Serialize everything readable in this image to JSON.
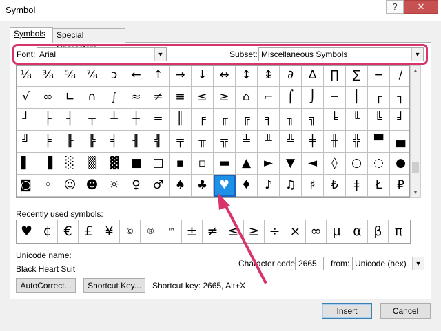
{
  "window": {
    "title": "Symbol",
    "help_glyph": "?",
    "close_glyph": "✕"
  },
  "tabs": [
    {
      "label": "Symbols"
    },
    {
      "label": "Special Characters"
    }
  ],
  "font": {
    "label": "Font:",
    "value": "Arial"
  },
  "subset": {
    "label": "Subset:",
    "value": "Miscellaneous Symbols"
  },
  "grid": {
    "rows": [
      [
        "⅛",
        "⅜",
        "⅝",
        "⅞",
        "ↄ",
        "←",
        "↑",
        "→",
        "↓",
        "↔",
        "↕",
        "↨",
        "∂",
        "∆",
        "∏",
        "∑",
        "−",
        "∕",
        "∙"
      ],
      [
        "√",
        "∞",
        "∟",
        "∩",
        "∫",
        "≈",
        "≠",
        "≡",
        "≤",
        "≥",
        "⌂",
        "⌐",
        "⌠",
        "⌡",
        "─",
        "│",
        "┌",
        "┐",
        "└"
      ],
      [
        "┘",
        "├",
        "┤",
        "┬",
        "┴",
        "┼",
        "═",
        "║",
        "╒",
        "╓",
        "╔",
        "╕",
        "╖",
        "╗",
        "╘",
        "╙",
        "╚",
        "╛",
        "╜"
      ],
      [
        "╝",
        "╞",
        "╟",
        "╠",
        "╡",
        "╢",
        "╣",
        "╤",
        "╥",
        "╦",
        "╧",
        "╨",
        "╩",
        "╪",
        "╫",
        "╬",
        "▀",
        "▄",
        "█"
      ],
      [
        "▌",
        "▐",
        "░",
        "▒",
        "▓",
        "■",
        "□",
        "▪",
        "▫",
        "▬",
        "▲",
        "►",
        "▼",
        "◄",
        "◊",
        "○",
        "◌",
        "●",
        "◘"
      ],
      [
        "◙",
        "◦",
        "☺",
        "☻",
        "☼",
        "♀",
        "♂",
        "♠",
        "♣",
        "♥",
        "♦",
        "♪",
        "♫",
        "♯",
        "₺",
        "ǂ",
        "Ł",
        "₽",
        "Ʀ"
      ]
    ],
    "selected": {
      "row": 5,
      "col": 9
    }
  },
  "recent": {
    "label": "Recently used symbols:",
    "items": [
      "♥",
      "¢",
      "€",
      "£",
      "¥",
      "©",
      "®",
      "™",
      "±",
      "≠",
      "≤",
      "≥",
      "÷",
      "×",
      "∞",
      "µ",
      "α",
      "β",
      "π"
    ]
  },
  "unicode": {
    "label": "Unicode name:",
    "name": "Black Heart Suit"
  },
  "charcode": {
    "label": "Character code:",
    "value": "2665",
    "from_label": "from:",
    "from_value": "Unicode (hex)"
  },
  "buttons": {
    "autocorrect": "AutoCorrect...",
    "shortcut": "Shortcut Key...",
    "insert": "Insert",
    "cancel": "Cancel"
  },
  "shortcut_text": "Shortcut key: 2665, Alt+X",
  "colors": {
    "highlight": "#d8336b",
    "selected_cell": "#1e90e8",
    "close_button": "#c75050"
  }
}
